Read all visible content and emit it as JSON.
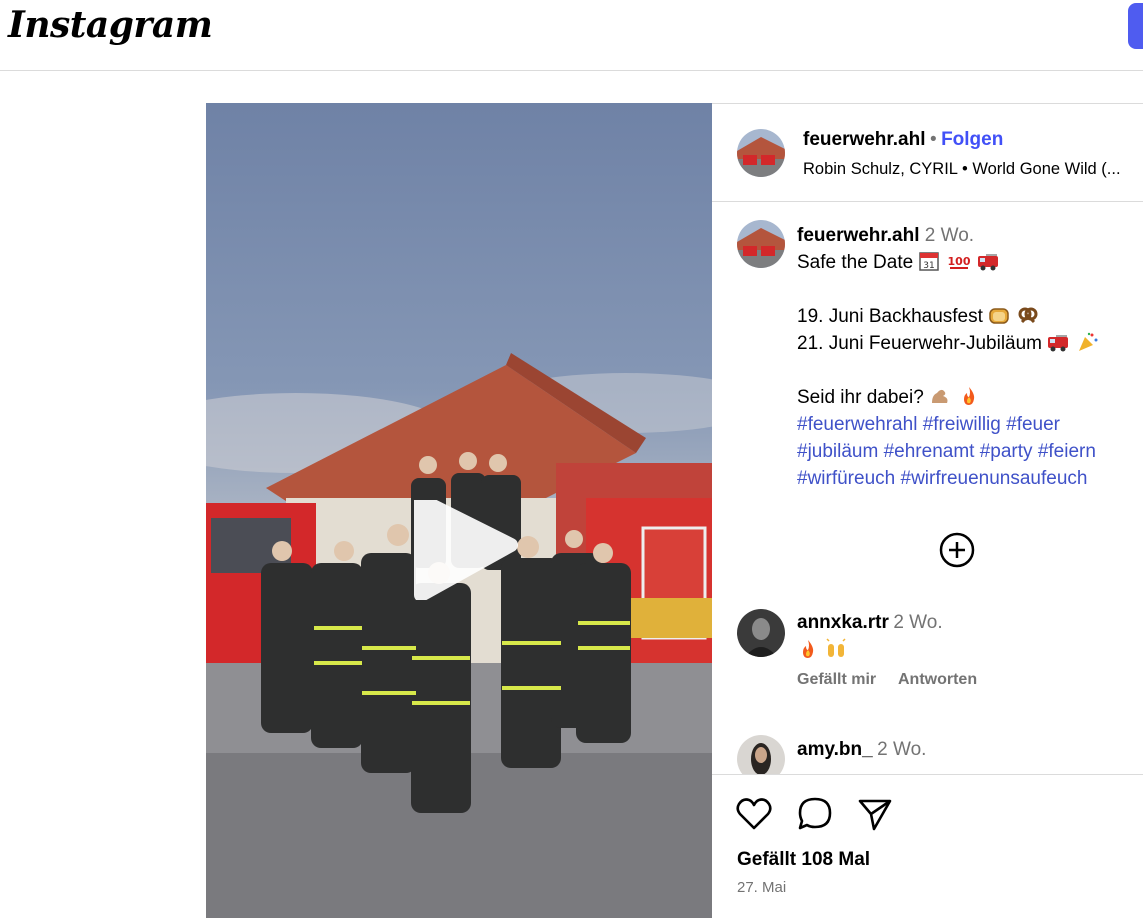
{
  "header": {
    "logo_text": "Instagram"
  },
  "post": {
    "username": "feuerwehr.ahl",
    "separator": "•",
    "follow_label": "Folgen",
    "music": "Robin Schulz, CYRIL • World Gone Wild (...",
    "caption": {
      "username": "feuerwehr.ahl",
      "time": "2 Wo.",
      "line1": "Safe the Date",
      "line2": "19. Juni Backhausfest",
      "line3": "21. Juni Feuerwehr-Jubiläum",
      "line4": "Seid ihr dabei?",
      "hashtags": [
        "#feuerwehrahl",
        "#freiwillig",
        "#feuer",
        "#jubiläum",
        "#ehrenamt",
        "#party",
        "#feiern",
        "#wirfüreuch",
        "#wirfreuenunsaufeuch"
      ]
    },
    "comments": [
      {
        "username": "annxka.rtr",
        "time": "2 Wo.",
        "like_label": "Gefällt mir",
        "reply_label": "Antworten"
      },
      {
        "username": "amy.bn_",
        "time": "2 Wo."
      }
    ],
    "likes": "Gefällt 108 Mal",
    "date": "27. Mai"
  },
  "icons": [
    "calendar-icon",
    "hundred-icon",
    "fire-engine-icon",
    "bread-icon",
    "pretzel-icon",
    "party-popper-icon",
    "flexed-biceps-icon",
    "fire-icon",
    "raising-hands-icon",
    "heart-icon",
    "comment-icon",
    "share-icon",
    "add-circle-icon",
    "play-icon"
  ],
  "colors": {
    "accent": "#4150f7",
    "hashtag": "#3f51c8",
    "muted": "#737373",
    "border": "#dbdbdb"
  }
}
